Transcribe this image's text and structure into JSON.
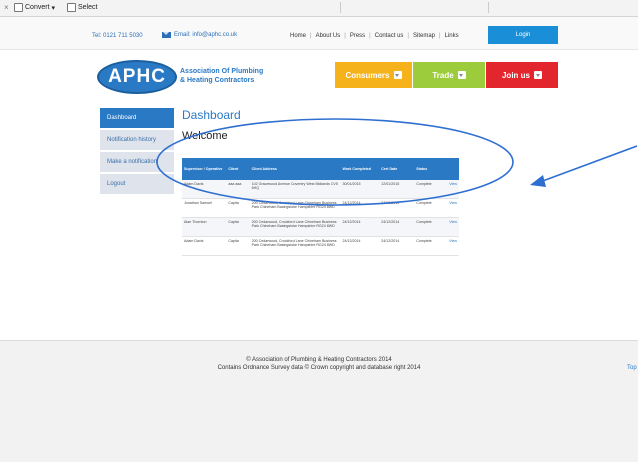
{
  "toolbar": {
    "close": "×",
    "convert": "Convert",
    "convert_caret": "▾",
    "select": "Select"
  },
  "topbar": {
    "tel": "Tel: 0121 711 5030",
    "email": "Email: info@aphc.co.uk",
    "links": [
      "Home",
      "About Us",
      "Press",
      "Contact us",
      "Sitemap",
      "Links"
    ],
    "separator": "|",
    "login": "Login"
  },
  "header": {
    "logo": "APHC",
    "org_line1": "Association Of Plumbing",
    "org_line2": "& Heating Contractors",
    "buttons": [
      {
        "label": "Consumers",
        "color": "#f5b21b"
      },
      {
        "label": "Trade",
        "color": "#9ccb3b"
      },
      {
        "label": "Join us",
        "color": "#e3262e"
      }
    ]
  },
  "sidebar": {
    "items": [
      {
        "label": "Dashboard",
        "active": true
      },
      {
        "label": "Notification history",
        "active": false
      },
      {
        "label": "Make a notification",
        "active": false
      },
      {
        "label": "Logout",
        "active": false
      }
    ]
  },
  "main": {
    "title": "Dashboard",
    "welcome": "Welcome",
    "table": {
      "headers": [
        "Supervisor / Operative",
        "Client",
        "Client Address",
        "Work Completed",
        "Cert Date",
        "Status",
        ""
      ],
      "rows": [
        [
          "Adam Davis",
          "aaa aaa",
          "102 Gracewood Avenue Coventry West Midlands CV5 6HQ",
          "30/01/2015",
          "12/01/2015",
          "Complete",
          "View"
        ],
        [
          "Jonathan Samuel",
          "Capita",
          "200 Cedarwood, Crockford Lane Chineham Business Park Chineham Basingstoke Hampshire RG24 8WD",
          "24/12/2014",
          "24/12/2014",
          "Complete",
          "View"
        ],
        [
          "Alan Thornton",
          "Capita",
          "200 Cedarwood, Crockford Lane Chineham Business Park Chineham Basingstoke Hampshire RG24 8WD",
          "24/12/2014",
          "24/12/2014",
          "Complete",
          "View"
        ],
        [
          "Adam Davis",
          "Capita",
          "200 Cedarwood, Crockford Lane Chineham Business Park Chineham Basingstoke Hampshire RG24 8WD",
          "24/12/2014",
          "24/12/2014",
          "Complete",
          "View"
        ]
      ]
    }
  },
  "footer": {
    "line1": "© Association of Plumbing & Heating Contractors 2014",
    "line2": "Contains Ordnance Survey data © Crown copyright and database right 2014",
    "top_link": "Top"
  },
  "colors": {
    "brand_blue": "#2a79c4",
    "annotation_blue": "#2f6fd0"
  }
}
